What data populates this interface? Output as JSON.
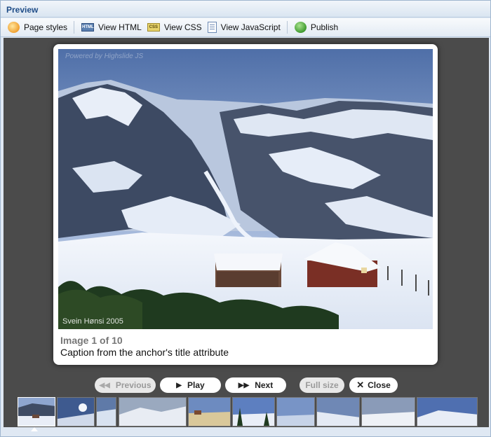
{
  "panel": {
    "title": "Preview"
  },
  "toolbar": {
    "items": [
      {
        "label": "Page styles",
        "icon": "page-styles-icon"
      },
      {
        "label": "View HTML",
        "icon": "html-icon",
        "badge": "HTML"
      },
      {
        "label": "View CSS",
        "icon": "css-icon",
        "badge": "CSS"
      },
      {
        "label": "View JavaScript",
        "icon": "javascript-icon"
      },
      {
        "label": "Publish",
        "icon": "publish-icon"
      }
    ]
  },
  "viewer": {
    "powered_by": "Powered by  Highslide JS",
    "photo_credit": "Svein Hønsi 2005",
    "counter": "Image 1 of 10",
    "caption": "Caption from the anchor's title attribute",
    "buttons": {
      "previous": "Previous",
      "play": "Play",
      "next": "Next",
      "full_size": "Full size",
      "close": "Close"
    }
  },
  "filmstrip": {
    "count": 10,
    "active_index": 0
  },
  "colors": {
    "stage": "#4b4b4b",
    "title_text": "#1e4c87",
    "panel_border": "#9fb6cf"
  }
}
